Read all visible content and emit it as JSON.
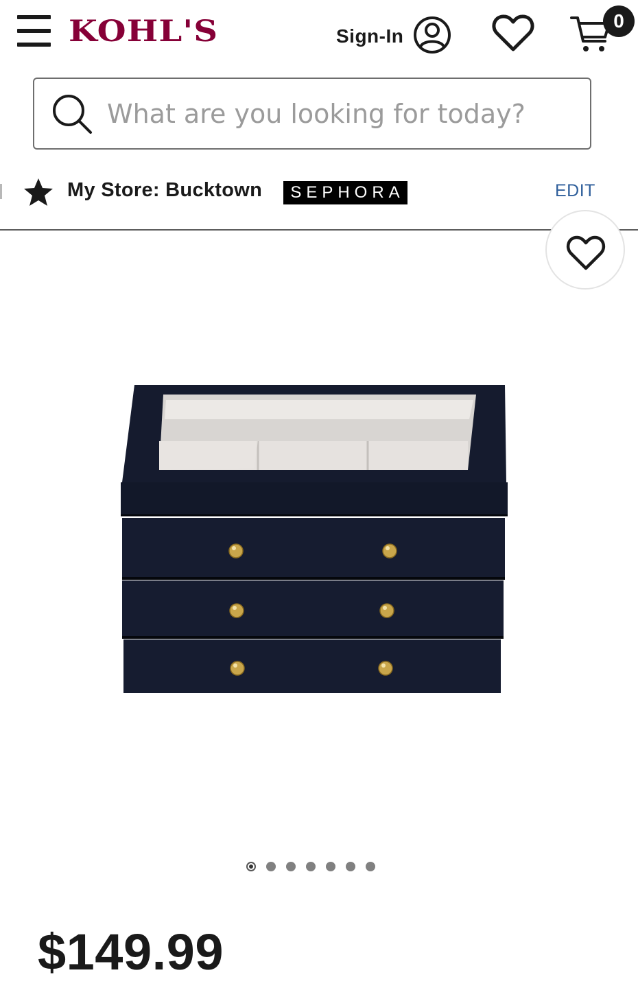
{
  "header": {
    "logo_text": "KOHL'S",
    "signin_label": "Sign-In",
    "cart_count": "0",
    "brand_color": "#860037",
    "icons": [
      "menu-icon",
      "user-icon",
      "heart-icon",
      "cart-icon"
    ]
  },
  "search": {
    "placeholder": "What are you looking for today?",
    "value": ""
  },
  "store": {
    "label": "My Store: Bucktown",
    "partner_badge": "SEPHORA",
    "edit_label": "EDIT",
    "link_color": "#2f5f9b"
  },
  "product": {
    "image_description_icon": "jewelry-box-image",
    "carousel_count": 7,
    "carousel_active_index": 0,
    "price": "$149.99"
  }
}
